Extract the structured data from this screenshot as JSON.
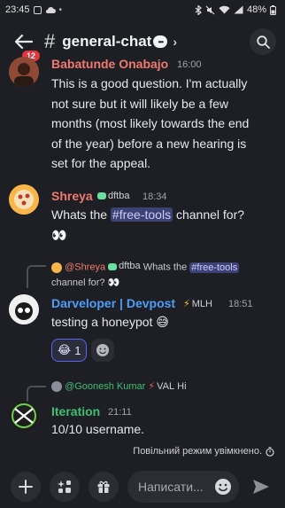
{
  "status_bar": {
    "time": "23:45",
    "battery": "48%"
  },
  "header": {
    "back_badge": "12",
    "channel_name": "general-chat"
  },
  "messages": [
    {
      "author": "Babatunde Onabajo",
      "time": "16:00",
      "lines": [
        "This is a good question. I'm actually",
        "not sure but it will likely be a few",
        "months (most likely towards the end",
        "of the year) before a new hearing is",
        "set for the appeal."
      ]
    },
    {
      "author": "Shreya",
      "tag": "dftba",
      "time": "18:34",
      "text_before": "Whats the ",
      "mention": "#free-tools",
      "text_after": " channel for?",
      "emoji": "👀"
    },
    {
      "reply": {
        "author": "@Shreya",
        "tag": "dftba",
        "text_before": "Whats the ",
        "mention": "#free-tools",
        "line2": "channel for? 👀"
      },
      "author": "Darveloper | Devpost",
      "tag": "MLH",
      "time": "18:51",
      "text": "testing a honeypot 😅",
      "reaction": {
        "emoji": "😂",
        "count": "1"
      }
    },
    {
      "reply": {
        "author": "@Goonesh Kumar",
        "tag": "VAL",
        "text": "Hi"
      },
      "author": "Iteration",
      "time": "21:11",
      "text": "10/10 username."
    }
  ],
  "slowmode": "Повільний режим увімкнено.",
  "composer": {
    "placeholder": "Написати..."
  },
  "colors": {
    "background": "#1e1f24",
    "author_red": "#f07a6e",
    "author_blue": "#4e9df7",
    "author_green": "#3fbf73",
    "accent": "#5865f2"
  }
}
